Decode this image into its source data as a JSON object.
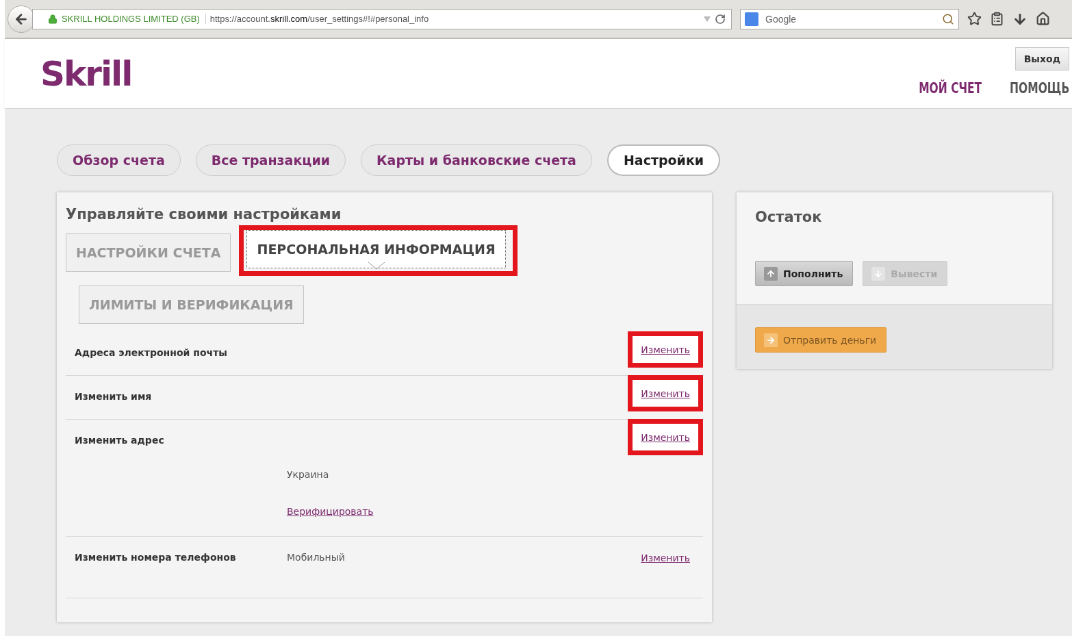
{
  "browser": {
    "identity": "SKRILL HOLDINGS LIMITED (GB)",
    "url": "https://account.**skrill.com**/user_settings#!#personal_info",
    "search_placeholder": "Google"
  },
  "header": {
    "logo": "Skrill",
    "logout": "Выход",
    "nav": [
      {
        "label": "МОЙ СЧЕТ",
        "selected": true
      },
      {
        "label": "ПОМОЩЬ",
        "selected": false
      }
    ]
  },
  "tabs": [
    {
      "label": "Обзор счета",
      "selected": false
    },
    {
      "label": "Все транзакции",
      "selected": false
    },
    {
      "label": "Карты и банковские счета",
      "selected": false
    },
    {
      "label": "Настройки",
      "selected": true
    }
  ],
  "settings": {
    "title": "Управляйте своими настройками",
    "subtabs": [
      {
        "label": "НАСТРОЙКИ СЧЕТА",
        "selected": false,
        "highlighted": false
      },
      {
        "label": "ПЕРСОНАЛЬНАЯ ИНФОРМАЦИЯ",
        "selected": true,
        "highlighted": true
      },
      {
        "label": "ЛИМИТЫ И ВЕРИФИКАЦИЯ",
        "selected": false,
        "highlighted": false
      }
    ],
    "rows": [
      {
        "label": "Адреса электронной почты",
        "action": "Изменить",
        "highlighted": true,
        "details": []
      },
      {
        "label": "Изменить имя",
        "action": "Изменить",
        "highlighted": true,
        "details": []
      },
      {
        "label": "Изменить адрес",
        "action": "Изменить",
        "highlighted": true,
        "details": [
          {
            "kind": "text",
            "text": "Украина"
          },
          {
            "kind": "link",
            "text": "Верифицировать"
          }
        ]
      },
      {
        "label": "Изменить номера телефонов",
        "action": "Изменить",
        "highlighted": false,
        "details": [
          {
            "kind": "text",
            "text": "Мобильный"
          }
        ]
      }
    ]
  },
  "balance": {
    "title": "Остаток",
    "buttons": [
      {
        "label": "Пополнить",
        "kind": "deposit",
        "disabled": false
      },
      {
        "label": "Вывести",
        "kind": "withdraw",
        "disabled": true
      }
    ],
    "send": "Отправить деньги"
  }
}
